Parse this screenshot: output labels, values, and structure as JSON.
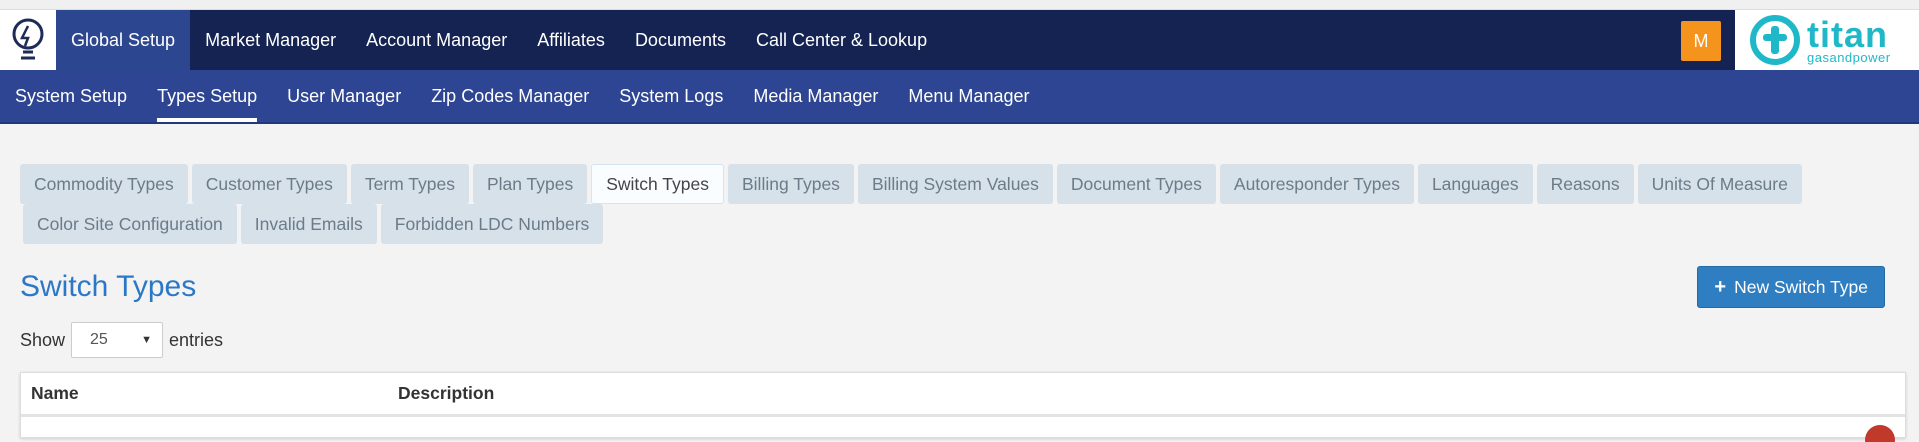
{
  "top_nav": {
    "items": [
      "Global Setup",
      "Market Manager",
      "Account Manager",
      "Affiliates",
      "Documents",
      "Call Center & Lookup"
    ],
    "active": "Global Setup",
    "avatar_initial": "M",
    "brand": {
      "name": "titan",
      "tagline": "gasandpower",
      "color": "#1fb8c9"
    }
  },
  "sub_nav": {
    "items": [
      "System Setup",
      "Types Setup",
      "User Manager",
      "Zip Codes Manager",
      "System Logs",
      "Media Manager",
      "Menu Manager"
    ],
    "active": "Types Setup"
  },
  "tabs": {
    "row1": [
      "Commodity Types",
      "Customer Types",
      "Term Types",
      "Plan Types",
      "Switch Types",
      "Billing Types",
      "Billing System Values",
      "Document Types",
      "Autoresponder Types",
      "Languages",
      "Reasons",
      "Units Of Measure"
    ],
    "row2": [
      "Color Site Configuration",
      "Invalid Emails",
      "Forbidden LDC Numbers"
    ],
    "active": "Switch Types"
  },
  "page": {
    "title": "Switch Types",
    "new_button_label": "New Switch Type",
    "show_label": "Show",
    "entries_label": "entries",
    "page_size": "25"
  },
  "table": {
    "columns": [
      "Name",
      "Description"
    ]
  },
  "colors": {
    "top_bar": "#142352",
    "sub_bar": "#2d4592",
    "accent": "#2c78c6",
    "avatar": "#f5941c"
  }
}
